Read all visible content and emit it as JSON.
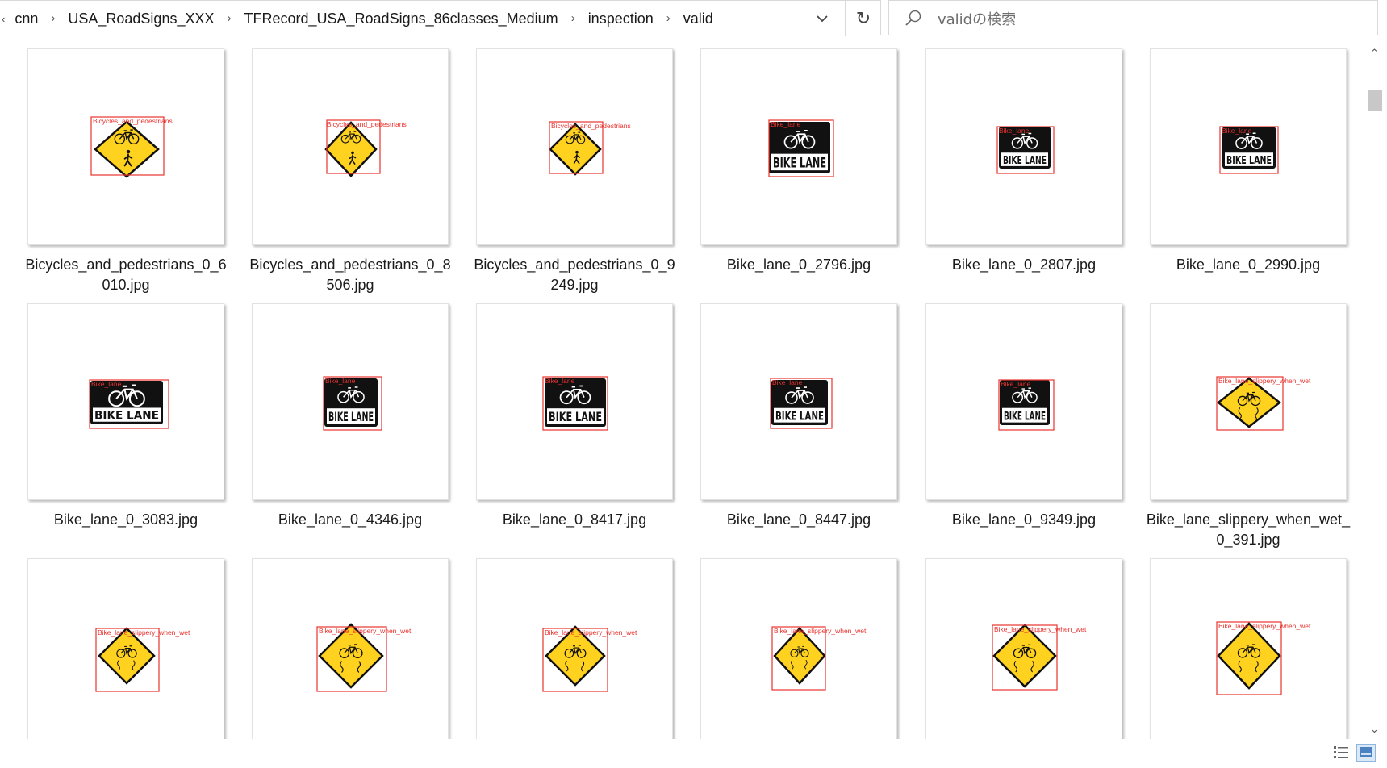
{
  "breadcrumb": {
    "lead": "‹",
    "segments": [
      "cnn",
      "USA_RoadSigns_XXX",
      "TFRecord_USA_RoadSigns_86classes_Medium",
      "inspection",
      "valid"
    ]
  },
  "search": {
    "placeholder": "validの検索"
  },
  "icons": {
    "dropdown": "chevron-down-icon",
    "refresh": "refresh-icon",
    "search": "search-icon",
    "scroll_up": "triangle-up-icon",
    "scroll_down": "triangle-down-icon",
    "details_view": "details-view-icon",
    "thumbnail_view": "large-icons-view-icon"
  },
  "colors": {
    "bbox": "#e8322e",
    "sign_yellow": "#ffd21f",
    "sign_black": "#111111"
  },
  "files": [
    {
      "name": "Bicycles_and_pedestrians_0_6010.jpg",
      "label": "Bicycles_and_pedestrians",
      "sign": "bicycles-pedestrians-sign"
    },
    {
      "name": "Bicycles_and_pedestrians_0_8506.jpg",
      "label": "Bicycles_and_pedestrians",
      "sign": "bicycles-pedestrians-sign"
    },
    {
      "name": "Bicycles_and_pedestrians_0_9249.jpg",
      "label": "Bicycles_and_pedestrians",
      "sign": "bicycles-pedestrians-sign"
    },
    {
      "name": "Bike_lane_0_2796.jpg",
      "label": "Bike_lane",
      "sign": "bike-lane-sign",
      "text": "BIKE LANE"
    },
    {
      "name": "Bike_lane_0_2807.jpg",
      "label": "Bike_lane",
      "sign": "bike-lane-sign",
      "text": "BIKE LANE"
    },
    {
      "name": "Bike_lane_0_2990.jpg",
      "label": "Bike_lane",
      "sign": "bike-lane-sign",
      "text": "BIKE LANE"
    },
    {
      "name": "Bike_lane_0_3083.jpg",
      "label": "Bike_lane",
      "sign": "bike-lane-sign",
      "text": "BIKE LANE"
    },
    {
      "name": "Bike_lane_0_4346.jpg",
      "label": "Bike_lane",
      "sign": "bike-lane-sign",
      "text": "BIKE LANE"
    },
    {
      "name": "Bike_lane_0_8417.jpg",
      "label": "Bike_lane",
      "sign": "bike-lane-sign",
      "text": "BIKE LANE"
    },
    {
      "name": "Bike_lane_0_8447.jpg",
      "label": "Bike_lane",
      "sign": "bike-lane-sign",
      "text": "BIKE LANE"
    },
    {
      "name": "Bike_lane_0_9349.jpg",
      "label": "Bike_lane",
      "sign": "bike-lane-sign",
      "text": "BIKE LANE"
    },
    {
      "name": "Bike_lane_slippery_when_wet_0_391.jpg",
      "label": "Bike_lane_slippery_when_wet",
      "sign": "bike-slippery-sign"
    },
    {
      "name": "",
      "label": "Bike_lane_slippery_when_wet",
      "sign": "bike-slippery-sign"
    },
    {
      "name": "",
      "label": "Bike_lane_slippery_when_wet",
      "sign": "bike-slippery-sign"
    },
    {
      "name": "",
      "label": "Bike_lane_slippery_when_wet",
      "sign": "bike-slippery-sign"
    },
    {
      "name": "",
      "label": "Bike_lane_slippery_when_wet",
      "sign": "bike-slippery-sign"
    },
    {
      "name": "",
      "label": "Bike_lane_slippery_when_wet",
      "sign": "bike-slippery-sign"
    },
    {
      "name": "",
      "label": "Bike_lane_slippery_when_wet",
      "sign": "bike-slippery-sign"
    }
  ]
}
